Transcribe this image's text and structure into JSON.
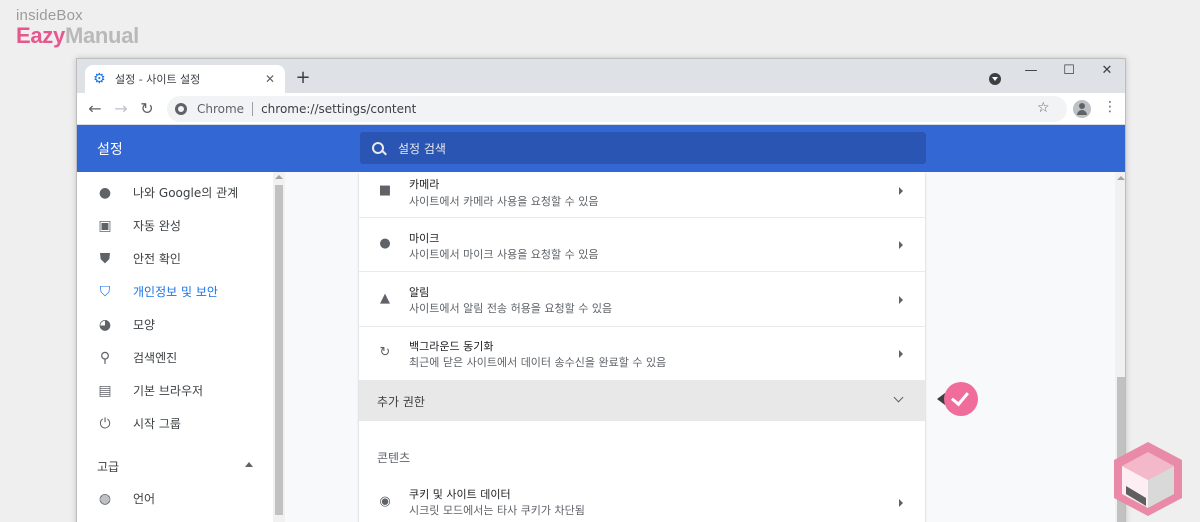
{
  "watermark": {
    "line1": "insideBox",
    "line2_a": "Eazy",
    "line2_b": "Manual"
  },
  "browser": {
    "tab_title": "설정 - 사이트 설정",
    "tab_close": "✕",
    "new_tab": "+",
    "window_min": "—",
    "window_max": "☐",
    "window_close": "✕",
    "back": "←",
    "forward": "→",
    "reload": "↻",
    "scheme_label": "Chrome",
    "url": "chrome://settings/content",
    "star": "☆",
    "menu": "⋮"
  },
  "header": {
    "title": "설정",
    "search_placeholder": "설정 검색"
  },
  "sidebar": {
    "items": [
      {
        "label": "나와 Google의 관계",
        "icon": "person-icon"
      },
      {
        "label": "자동 완성",
        "icon": "clipboard-icon"
      },
      {
        "label": "안전 확인",
        "icon": "shield-icon"
      },
      {
        "label": "개인정보 및 보안",
        "icon": "shield-half-icon",
        "active": true
      },
      {
        "label": "모양",
        "icon": "palette-icon"
      },
      {
        "label": "검색엔진",
        "icon": "search-icon"
      },
      {
        "label": "기본 브라우저",
        "icon": "browser-icon"
      },
      {
        "label": "시작 그룹",
        "icon": "power-icon"
      },
      {
        "label": "언어",
        "icon": "globe-icon"
      }
    ],
    "advanced_label": "고급"
  },
  "content": {
    "rows": [
      {
        "title": "카메라",
        "subtitle": "사이트에서 카메라 사용을 요청할 수 있음",
        "icon": "camera-icon"
      },
      {
        "title": "마이크",
        "subtitle": "사이트에서 마이크 사용을 요청할 수 있음",
        "icon": "microphone-icon"
      },
      {
        "title": "알림",
        "subtitle": "사이트에서 알림 전송 허용을 요청할 수 있음",
        "icon": "bell-icon"
      },
      {
        "title": "백그라운드 동기화",
        "subtitle": "최근에 닫은 사이트에서 데이터 송수신을 완료할 수 있음",
        "icon": "sync-icon"
      }
    ],
    "extra_permissions_label": "추가 권한",
    "content_section_label": "콘텐츠",
    "cookies_row": {
      "title": "쿠키 및 사이트 데이터",
      "subtitle": "시크릿 모드에서는 타사 쿠키가 차단됨",
      "icon": "cookie-icon"
    }
  },
  "colors": {
    "header_blue": "#3368d4",
    "search_blue": "#2a55b3",
    "active_blue": "#1a73e8",
    "badge_pink": "#f06c9b"
  }
}
